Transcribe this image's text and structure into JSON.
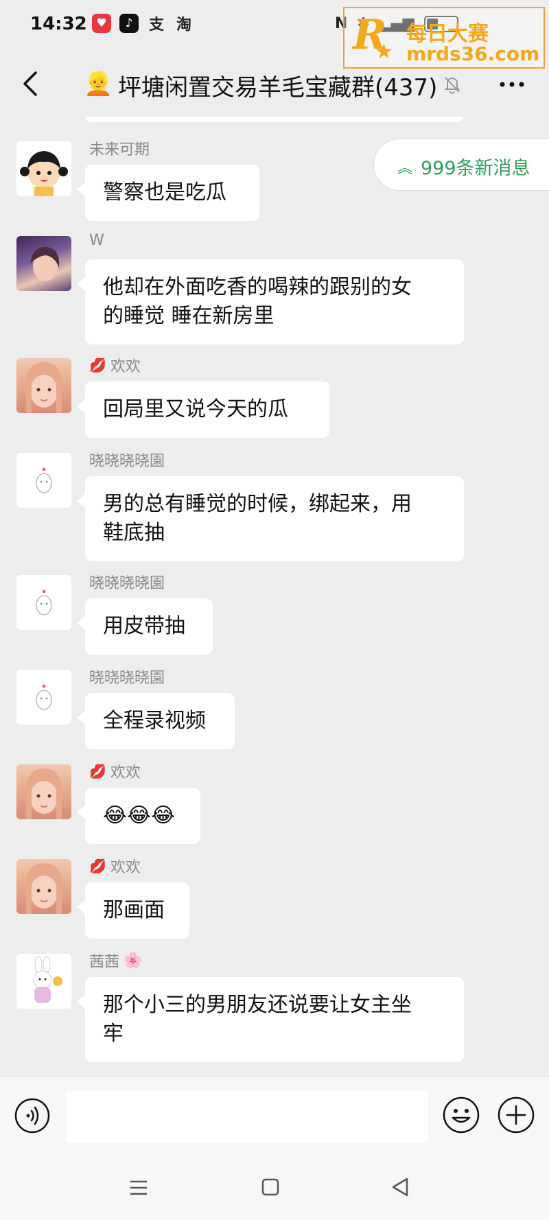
{
  "status_bar": {
    "time": "14:32",
    "app_icons": [
      "pinduoduo-icon",
      "tiktok-icon",
      "alipay-icon",
      "taobao-icon"
    ],
    "alipay_label": "支",
    "taobao_label": "淘",
    "nfc": "N",
    "bluetooth": "✱",
    "battery_level": 0.35
  },
  "watermark": {
    "logo_letter": "R",
    "text_cn": "每日大赛",
    "url": "mrds36.com"
  },
  "header": {
    "back_icon": "chevron-left-icon",
    "group_emoji": "👱",
    "title": "坪塘闲置交易羊毛宝藏群(437)",
    "mute_icon": "bell-off-icon",
    "more_icon": "more-dots-icon"
  },
  "new_messages": {
    "label": "999条新消息",
    "icon": "double-chevron-up-icon"
  },
  "messages": [
    {
      "sender": "未来可期",
      "tag": "",
      "lines": [
        "警察也是吃瓜"
      ]
    },
    {
      "sender": "W",
      "tag": "",
      "lines": [
        "他却在外面吃香的喝辣的跟别的女",
        "的睡觉 睡在新房里"
      ]
    },
    {
      "sender": "欢欢",
      "tag": "💋",
      "lines": [
        "回局里又说今天的瓜"
      ]
    },
    {
      "sender": "晓晓晓晓園",
      "tag": "",
      "lines": [
        "男的总有睡觉的时候，绑起来，用",
        "鞋底抽"
      ]
    },
    {
      "sender": "晓晓晓晓園",
      "tag": "",
      "lines": [
        "用皮带抽"
      ]
    },
    {
      "sender": "晓晓晓晓園",
      "tag": "",
      "lines": [
        "全程录视频"
      ]
    },
    {
      "sender": "欢欢",
      "tag": "💋",
      "lines": [
        "😂😂😂"
      ]
    },
    {
      "sender": "欢欢",
      "tag": "💋",
      "lines": [
        "那画面"
      ]
    },
    {
      "sender": "茜茜",
      "tag": "🌸",
      "lines": [
        "那个小三的男朋友还说要让女主坐",
        "牢"
      ]
    }
  ],
  "input_bar": {
    "voice_icon": "voice-icon",
    "text_value": "",
    "emoji_icon": "smiley-icon",
    "plus_icon": "plus-circle-icon"
  },
  "nav_bar": {
    "menu_icon": "menu-icon",
    "home_icon": "home-square-icon",
    "back_icon": "back-triangle-icon"
  },
  "colors": {
    "background": "#ededed",
    "bubble": "#ffffff",
    "accent_green": "#2e9d5a",
    "sender_gray": "#8a8a8a",
    "watermark_orange": "#f4a91c"
  }
}
